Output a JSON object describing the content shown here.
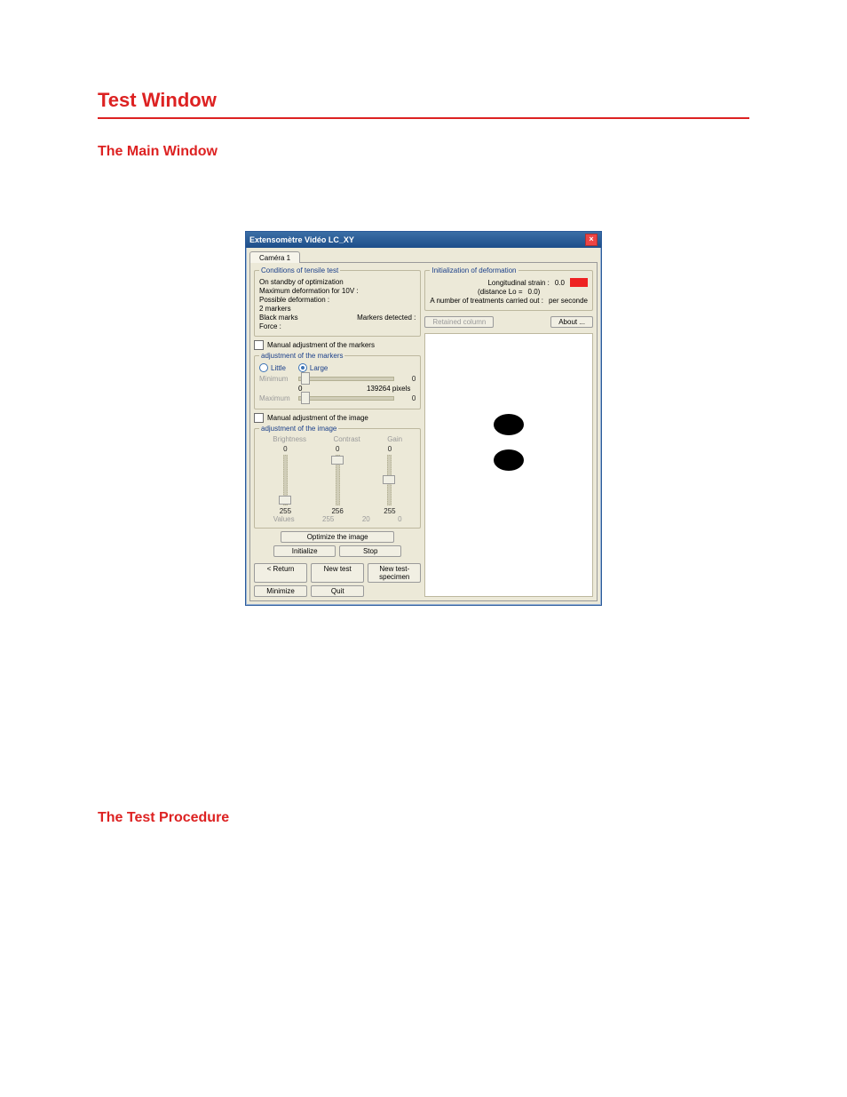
{
  "doc": {
    "title": "Test Window",
    "section1": "The Main Window",
    "section2": "The Test Procedure"
  },
  "app": {
    "title": "Extensomètre Vidéo LC_XY",
    "tab": "Caméra 1",
    "conditions": {
      "legend": "Conditions of tensile test",
      "l1": "On standby of optimization",
      "l2": "Maximum deformation for 10V :",
      "l3": "Possible deformation :",
      "l4": "2 markers",
      "l5a": "Black marks",
      "l5b": "Markers detected :",
      "l6": "Force :"
    },
    "markers": {
      "check": "Manual adjustment of the markers",
      "legend": "adjustment of the markers",
      "radio_little": "Little",
      "radio_large": "Large",
      "min_label": "Minimum",
      "min_val": "0",
      "mid_zero": "0",
      "mid_pixels": "139264 pixels",
      "max_label": "Maximum",
      "max_val": "0"
    },
    "image_adj": {
      "check": "Manual adjustment of the image",
      "legend": "adjustment of the image",
      "brightness": "Brightness",
      "contrast": "Contrast",
      "gain": "Gain",
      "top0": "0",
      "b_bot": "255",
      "c_bot": "256",
      "g_bot": "255",
      "values": "Values",
      "v1": "255",
      "v2": "20",
      "v3": "0"
    },
    "buttons": {
      "optimize": "Optimize the image",
      "initialize": "Initialize",
      "stop": "Stop",
      "return": "< Return",
      "new_test": "New test",
      "new_spec": "New test-specimen",
      "minimize": "Minimize",
      "quit": "Quit"
    },
    "vis": {
      "legend": "Initialization of deformation",
      "long_label": "Longitudinal strain :",
      "long_val": "0.0",
      "dist_label": "(distance Lo =",
      "dist_val": "0.0)",
      "treat_label": "A number of treatments carried out :",
      "treat_unit": "per seconde"
    },
    "retained": "Retained column",
    "about": "About ..."
  }
}
